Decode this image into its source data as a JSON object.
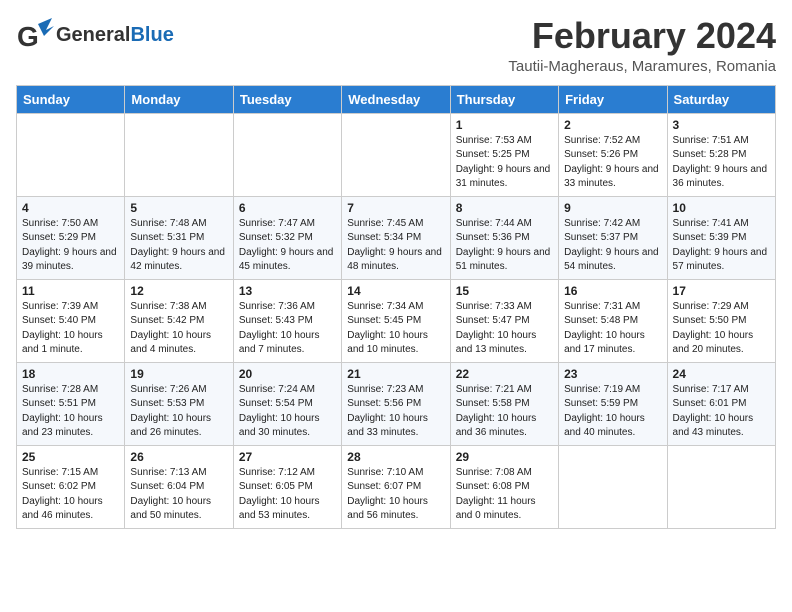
{
  "header": {
    "logo_general": "General",
    "logo_blue": "Blue",
    "month": "February 2024",
    "location": "Tautii-Magheraus, Maramures, Romania"
  },
  "weekdays": [
    "Sunday",
    "Monday",
    "Tuesday",
    "Wednesday",
    "Thursday",
    "Friday",
    "Saturday"
  ],
  "weeks": [
    [
      {
        "day": "",
        "content": ""
      },
      {
        "day": "",
        "content": ""
      },
      {
        "day": "",
        "content": ""
      },
      {
        "day": "",
        "content": ""
      },
      {
        "day": "1",
        "content": "Sunrise: 7:53 AM\nSunset: 5:25 PM\nDaylight: 9 hours and 31 minutes."
      },
      {
        "day": "2",
        "content": "Sunrise: 7:52 AM\nSunset: 5:26 PM\nDaylight: 9 hours and 33 minutes."
      },
      {
        "day": "3",
        "content": "Sunrise: 7:51 AM\nSunset: 5:28 PM\nDaylight: 9 hours and 36 minutes."
      }
    ],
    [
      {
        "day": "4",
        "content": "Sunrise: 7:50 AM\nSunset: 5:29 PM\nDaylight: 9 hours and 39 minutes."
      },
      {
        "day": "5",
        "content": "Sunrise: 7:48 AM\nSunset: 5:31 PM\nDaylight: 9 hours and 42 minutes."
      },
      {
        "day": "6",
        "content": "Sunrise: 7:47 AM\nSunset: 5:32 PM\nDaylight: 9 hours and 45 minutes."
      },
      {
        "day": "7",
        "content": "Sunrise: 7:45 AM\nSunset: 5:34 PM\nDaylight: 9 hours and 48 minutes."
      },
      {
        "day": "8",
        "content": "Sunrise: 7:44 AM\nSunset: 5:36 PM\nDaylight: 9 hours and 51 minutes."
      },
      {
        "day": "9",
        "content": "Sunrise: 7:42 AM\nSunset: 5:37 PM\nDaylight: 9 hours and 54 minutes."
      },
      {
        "day": "10",
        "content": "Sunrise: 7:41 AM\nSunset: 5:39 PM\nDaylight: 9 hours and 57 minutes."
      }
    ],
    [
      {
        "day": "11",
        "content": "Sunrise: 7:39 AM\nSunset: 5:40 PM\nDaylight: 10 hours and 1 minute."
      },
      {
        "day": "12",
        "content": "Sunrise: 7:38 AM\nSunset: 5:42 PM\nDaylight: 10 hours and 4 minutes."
      },
      {
        "day": "13",
        "content": "Sunrise: 7:36 AM\nSunset: 5:43 PM\nDaylight: 10 hours and 7 minutes."
      },
      {
        "day": "14",
        "content": "Sunrise: 7:34 AM\nSunset: 5:45 PM\nDaylight: 10 hours and 10 minutes."
      },
      {
        "day": "15",
        "content": "Sunrise: 7:33 AM\nSunset: 5:47 PM\nDaylight: 10 hours and 13 minutes."
      },
      {
        "day": "16",
        "content": "Sunrise: 7:31 AM\nSunset: 5:48 PM\nDaylight: 10 hours and 17 minutes."
      },
      {
        "day": "17",
        "content": "Sunrise: 7:29 AM\nSunset: 5:50 PM\nDaylight: 10 hours and 20 minutes."
      }
    ],
    [
      {
        "day": "18",
        "content": "Sunrise: 7:28 AM\nSunset: 5:51 PM\nDaylight: 10 hours and 23 minutes."
      },
      {
        "day": "19",
        "content": "Sunrise: 7:26 AM\nSunset: 5:53 PM\nDaylight: 10 hours and 26 minutes."
      },
      {
        "day": "20",
        "content": "Sunrise: 7:24 AM\nSunset: 5:54 PM\nDaylight: 10 hours and 30 minutes."
      },
      {
        "day": "21",
        "content": "Sunrise: 7:23 AM\nSunset: 5:56 PM\nDaylight: 10 hours and 33 minutes."
      },
      {
        "day": "22",
        "content": "Sunrise: 7:21 AM\nSunset: 5:58 PM\nDaylight: 10 hours and 36 minutes."
      },
      {
        "day": "23",
        "content": "Sunrise: 7:19 AM\nSunset: 5:59 PM\nDaylight: 10 hours and 40 minutes."
      },
      {
        "day": "24",
        "content": "Sunrise: 7:17 AM\nSunset: 6:01 PM\nDaylight: 10 hours and 43 minutes."
      }
    ],
    [
      {
        "day": "25",
        "content": "Sunrise: 7:15 AM\nSunset: 6:02 PM\nDaylight: 10 hours and 46 minutes."
      },
      {
        "day": "26",
        "content": "Sunrise: 7:13 AM\nSunset: 6:04 PM\nDaylight: 10 hours and 50 minutes."
      },
      {
        "day": "27",
        "content": "Sunrise: 7:12 AM\nSunset: 6:05 PM\nDaylight: 10 hours and 53 minutes."
      },
      {
        "day": "28",
        "content": "Sunrise: 7:10 AM\nSunset: 6:07 PM\nDaylight: 10 hours and 56 minutes."
      },
      {
        "day": "29",
        "content": "Sunrise: 7:08 AM\nSunset: 6:08 PM\nDaylight: 11 hours and 0 minutes."
      },
      {
        "day": "",
        "content": ""
      },
      {
        "day": "",
        "content": ""
      }
    ]
  ]
}
